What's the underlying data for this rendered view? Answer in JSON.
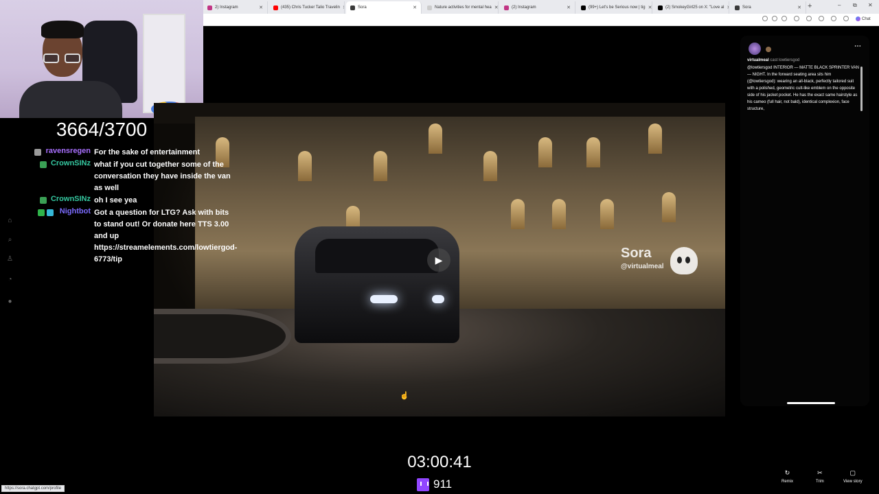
{
  "browser": {
    "tabs": [
      {
        "label": "2) Instagram",
        "fav_color": "#c13584"
      },
      {
        "label": "(435) Chris Tucker Talio Travelin",
        "fav_color": "#ff0000"
      },
      {
        "label": "Sora",
        "fav_color": "#3a3a3a"
      },
      {
        "label": "Nature activities for mental hea",
        "fav_color": "#cccccc"
      },
      {
        "label": "(2) Instagram",
        "fav_color": "#c13584"
      },
      {
        "label": "(99+) Let's be Serious now | tig",
        "fav_color": "#000000"
      },
      {
        "label": "(2) SmokeyGirl25 on X: \"Love al",
        "fav_color": "#000000"
      },
      {
        "label": "Sora",
        "fav_color": "#3a3a3a"
      }
    ],
    "new_tab": "+",
    "chat_label": "Chat",
    "window_controls": [
      "–",
      "⧉",
      "✕"
    ]
  },
  "stream": {
    "counter": "3664/3700",
    "timer": "03:00:41",
    "viewers": "911",
    "accent": "#9146ff"
  },
  "chat": [
    {
      "user": "ravensregen",
      "color": "#a970ff",
      "message": "For the sake of entertainment",
      "badge_colors": [
        "#9a9a9a"
      ]
    },
    {
      "user": "CrownSINz",
      "color": "#35c8a0",
      "message": "what if you cut together some of the conversation they have inside the van as well",
      "badge_colors": [
        "#3aa055"
      ]
    },
    {
      "user": "CrownSINz",
      "color": "#35c8a0",
      "message": "oh I see yea",
      "badge_colors": [
        "#3aa055"
      ]
    },
    {
      "user": "Nightbot",
      "color": "#7c6cff",
      "message": "Got a question for LTG? Ask with bits to stand out! Or donate here TTS 3.00 and up https://streamelements.com/lowtiergod-6773/tip",
      "badge_colors": [
        "#2fb34a",
        "#35b8d8"
      ]
    }
  ],
  "video": {
    "watermark": "Sora",
    "handle": "@virtualmeal",
    "play_icon": "play-icon"
  },
  "panel": {
    "author": "virtualmeal",
    "cast_label": "cast lowtiersgod",
    "description": "@lowtiersgod INTERIOR — MATTE BLACK SPRINTER VAN — NIGHT. In the forward seating area sits him (@lowtiersgod): wearing an all-black, perfectly tailored suit with a polished, geometric cult-like emblem on the opposite side of his jacket pocket. He has the exact same hairstyle as his cameo (full hair, not bald), identical complexion, face structure,",
    "more_icon": "more-icon"
  },
  "actions": [
    {
      "label": "Remix",
      "icon": "↻"
    },
    {
      "label": "Trim",
      "icon": "✂"
    },
    {
      "label": "View story",
      "icon": "▢"
    }
  ],
  "status_url": "https://sora.chatgpt.com/profile"
}
